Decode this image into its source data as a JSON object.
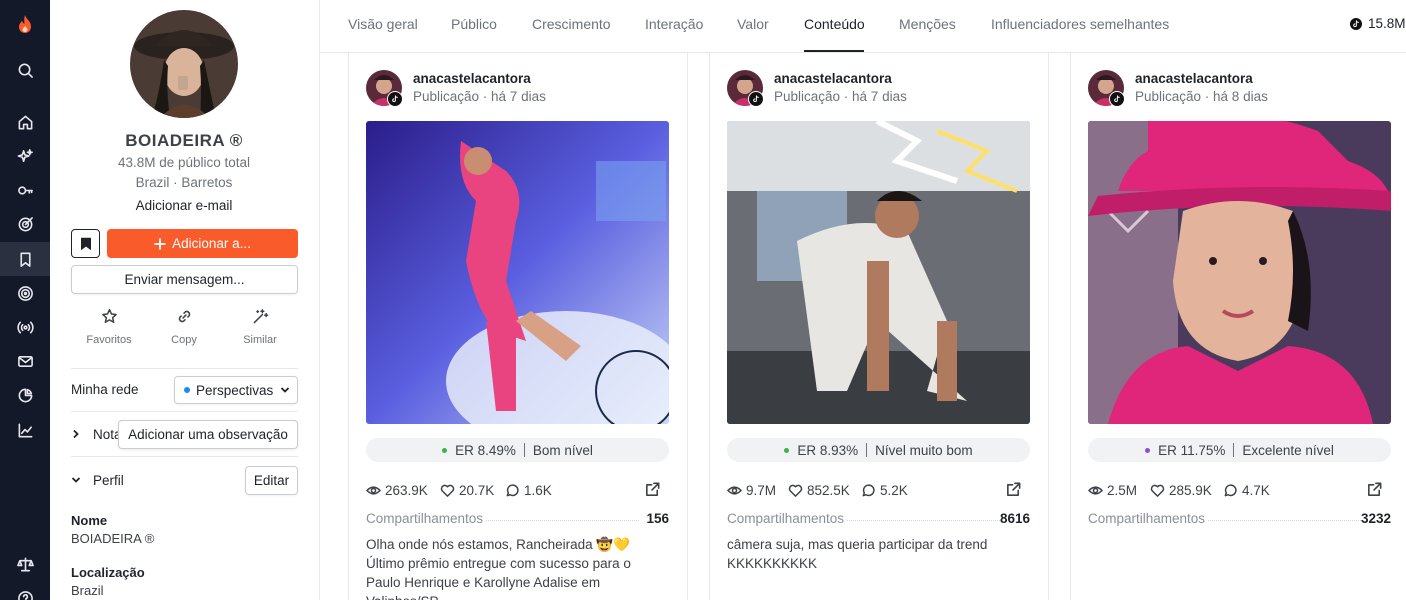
{
  "app": {
    "accent": "#fa5b2a",
    "rail_icons": [
      "flame-logo-icon",
      "search-icon",
      "home-icon",
      "sparkles-icon",
      "key-icon",
      "target-icon",
      "bookmark-icon",
      "radar-icon",
      "broadcast-icon",
      "mail-icon",
      "pie-chart-icon",
      "trend-icon",
      "scale-icon",
      "help-icon"
    ]
  },
  "profile": {
    "name": "BOIADEIRA ®",
    "audience": "43.8M de público total",
    "location": "Brazil · Barretos",
    "add_email": "Adicionar e-mail",
    "add_button": "Adicionar a...",
    "message_button": "Enviar mensagem...",
    "actions": [
      {
        "label": "Favoritos",
        "icon": "star-icon"
      },
      {
        "label": "Copy",
        "icon": "link-icon"
      },
      {
        "label": "Similar",
        "icon": "magic-wand-icon"
      }
    ],
    "network_label": "Minha rede",
    "network_value": "Perspectivas",
    "note_label": "Nota",
    "note_tooltip": "Adicionar uma observação",
    "perfil_label": "Perfil",
    "edit_button": "Editar",
    "fields": [
      {
        "label": "Nome",
        "value": "BOIADEIRA ®"
      },
      {
        "label": "Localização",
        "value": "Brazil"
      }
    ]
  },
  "tabs": {
    "items": [
      "Visão geral",
      "Público",
      "Crescimento",
      "Interação",
      "Valor",
      "Conteúdo",
      "Menções",
      "Influenciadores semelhantes"
    ],
    "active": "Conteúdo",
    "followers": "15.8M"
  },
  "posts": [
    {
      "username": "anacastelacantora",
      "meta": "Publicação · há 7 dias",
      "er": "ER 8.49%",
      "er_level": "Bom nível",
      "er_color": "#3bb54a",
      "views": "263.9K",
      "likes": "20.7K",
      "comments": "1.6K",
      "shares_label": "Compartilhamentos",
      "shares": "156",
      "caption": "Olha onde nós estamos, Rancheirada 🤠💛  Último prêmio entregue com sucesso para o Paulo Henrique e Karollyne Adalise em Valinhos/SP, ..."
    },
    {
      "username": "anacastelacantora",
      "meta": "Publicação · há 7 dias",
      "er": "ER 8.93%",
      "er_level": "Nível muito bom",
      "er_color": "#3bb54a",
      "views": "9.7M",
      "likes": "852.5K",
      "comments": "5.2K",
      "shares_label": "Compartilhamentos",
      "shares": "8616",
      "caption": "câmera suja, mas queria participar da trend KKKKKKKKKK"
    },
    {
      "username": "anacastelacantora",
      "meta": "Publicação · há 8 dias",
      "er": "ER 11.75%",
      "er_level": "Excelente nível",
      "er_color": "#8b4fd6",
      "views": "2.5M",
      "likes": "285.9K",
      "comments": "4.7K",
      "shares_label": "Compartilhamentos",
      "shares": "3232",
      "caption": ""
    }
  ]
}
